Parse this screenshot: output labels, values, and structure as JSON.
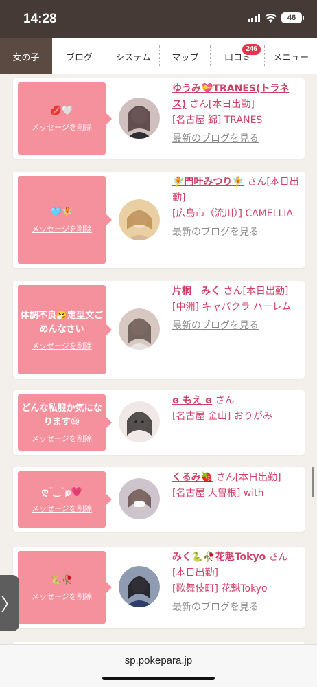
{
  "status": {
    "time": "14:28",
    "battery": "46"
  },
  "nav": {
    "tabs": [
      {
        "label": "女の子",
        "active": true
      },
      {
        "label": "ブログ"
      },
      {
        "label": "システム"
      },
      {
        "label": "マップ"
      },
      {
        "label": "口コミ",
        "badge": "246"
      },
      {
        "label": "メニュー"
      }
    ]
  },
  "cards": [
    {
      "message": "💋🤍",
      "delete_label": "メッセージを削除",
      "name": "ゆうみ💝TRANES(トラネス)",
      "suffix": " さん[本日出勤]",
      "shop": "[名古屋 錦] TRANES",
      "blog_link": "最新のブログを見る"
    },
    {
      "message": "🩵🧚",
      "delete_label": "メッセージを削除",
      "name": "🧚門叶みつり🧚",
      "suffix": " さん[本日出勤]",
      "shop": "[広島市（流川）] CAMELLIA",
      "blog_link": "最新のブログを見る"
    },
    {
      "message": "体調不良🤧定型文ごめんなさい",
      "delete_label": "メッセージを削除",
      "name": "片桐　みく",
      "suffix": " さん[本日出勤]",
      "shop": "[中洲] キャバクラ ハーレム",
      "blog_link": "最新のブログを見る"
    },
    {
      "message": "どんな私服か気になります😆",
      "delete_label": "メッセージを削除",
      "name": "ɞ もえ ɞ",
      "suffix": " さん",
      "shop": "[名古屋 金山] おりがみ",
      "blog_link": ""
    },
    {
      "message": "ღ˘‿˘ற💗",
      "delete_label": "メッセージを削除",
      "name": "くるみ🍓",
      "suffix": " さん[本日出勤]",
      "shop": "[名古屋 大曽根] with",
      "blog_link": ""
    },
    {
      "message": "🐍🥀",
      "delete_label": "メッセージを削除",
      "name": "みく🐍🥀花魁Tokyo",
      "suffix": " さん[本日出勤]",
      "shop": "[歌舞伎町] 花魁Tokyo",
      "blog_link": "最新のブログを見る"
    }
  ],
  "side_tab": {
    "glyph": "〉"
  },
  "url": "sp.pokepara.jp",
  "colors": {
    "accent": "#d03f68",
    "message_bg": "#f5919d",
    "nav_active": "#5a4a42",
    "status_bar": "#453a35"
  }
}
